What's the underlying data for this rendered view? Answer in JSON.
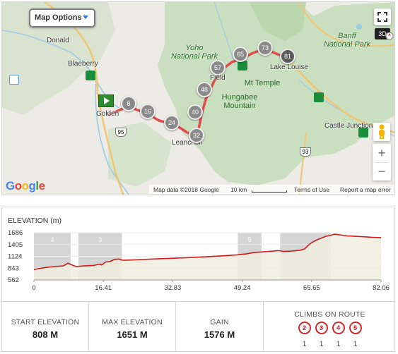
{
  "map": {
    "options_label": "Map Options",
    "btn_3d": "3D",
    "zoom_in": "+",
    "zoom_out": "−",
    "google_logo": [
      "G",
      "o",
      "o",
      "g",
      "l",
      "e"
    ],
    "attribution": {
      "map_data": "Map data ©2018 Google",
      "scale": "10 km",
      "terms": "Terms of Use",
      "report": "Report a map error"
    },
    "places": {
      "donald": "Donald",
      "blaeberry": "Blaeberry",
      "golden": "Golden",
      "field": "Field",
      "leanchoil": "Leanchoil",
      "lake_louise": "Lake Louise",
      "castle_junction": "Castle Junction"
    },
    "parks": {
      "yoho": [
        "Yoho",
        "National Park"
      ],
      "banff": [
        "Banff",
        "National Park"
      ]
    },
    "mountains": {
      "mt_temple": "Mt Temple",
      "hungabee": [
        "Hungabee",
        "Mountain"
      ]
    },
    "roads": {
      "hwy95": "95",
      "hwy93": "93"
    },
    "markers": [
      "8",
      "16",
      "24",
      "32",
      "40",
      "48",
      "57",
      "65",
      "73",
      "81"
    ]
  },
  "chart": {
    "title": "ELEVATION (m)"
  },
  "chart_data": {
    "type": "area",
    "ylabel": "ELEVATION (m)",
    "ylim": [
      562,
      1686
    ],
    "yticks": [
      "1686",
      "1405",
      "1124",
      "843",
      "562"
    ],
    "xlim": [
      0,
      82.06
    ],
    "xticks": [
      "0",
      "16.41",
      "32.83",
      "49.24",
      "65.65",
      "82.06"
    ],
    "climb_segments": [
      {
        "label": "4",
        "x": [
          0,
          8.7
        ]
      },
      {
        "label": "3",
        "x": [
          10.5,
          20.8
        ]
      },
      {
        "label": "5",
        "x": [
          48.2,
          53.8
        ]
      },
      {
        "label": "",
        "x": [
          58.2,
          70.2
        ]
      }
    ],
    "series": [
      {
        "x": [
          0,
          1,
          3,
          5,
          7,
          8,
          9,
          10,
          12,
          14,
          15.5,
          16,
          17,
          18,
          19,
          20,
          21,
          24,
          28,
          32,
          36,
          40,
          44,
          48,
          50,
          52,
          54,
          56,
          58,
          59,
          60,
          61,
          62,
          63,
          64,
          65,
          66,
          67,
          68,
          69,
          70,
          71,
          72,
          74,
          76,
          78,
          80,
          82.06
        ],
        "values": [
          808,
          830,
          860,
          880,
          900,
          960,
          920,
          880,
          900,
          905,
          940,
          920,
          990,
          1000,
          1050,
          1060,
          1030,
          1040,
          1060,
          1075,
          1090,
          1110,
          1130,
          1160,
          1180,
          1215,
          1230,
          1245,
          1260,
          1240,
          1245,
          1250,
          1260,
          1270,
          1300,
          1400,
          1470,
          1520,
          1560,
          1600,
          1620,
          1651,
          1640,
          1610,
          1600,
          1590,
          1575,
          1570
        ]
      }
    ],
    "grid": true
  },
  "stats": {
    "start": {
      "label": "START ELEVATION",
      "value": "808 M"
    },
    "max": {
      "label": "MAX ELEVATION",
      "value": "1651 M"
    },
    "gain": {
      "label": "GAIN",
      "value": "1576 M"
    },
    "climbs": {
      "label": "CLIMBS ON ROUTE",
      "items": [
        {
          "category": "2",
          "count": "1"
        },
        {
          "category": "3",
          "count": "1"
        },
        {
          "category": "4",
          "count": "1"
        },
        {
          "category": "5",
          "count": "1"
        }
      ]
    }
  }
}
